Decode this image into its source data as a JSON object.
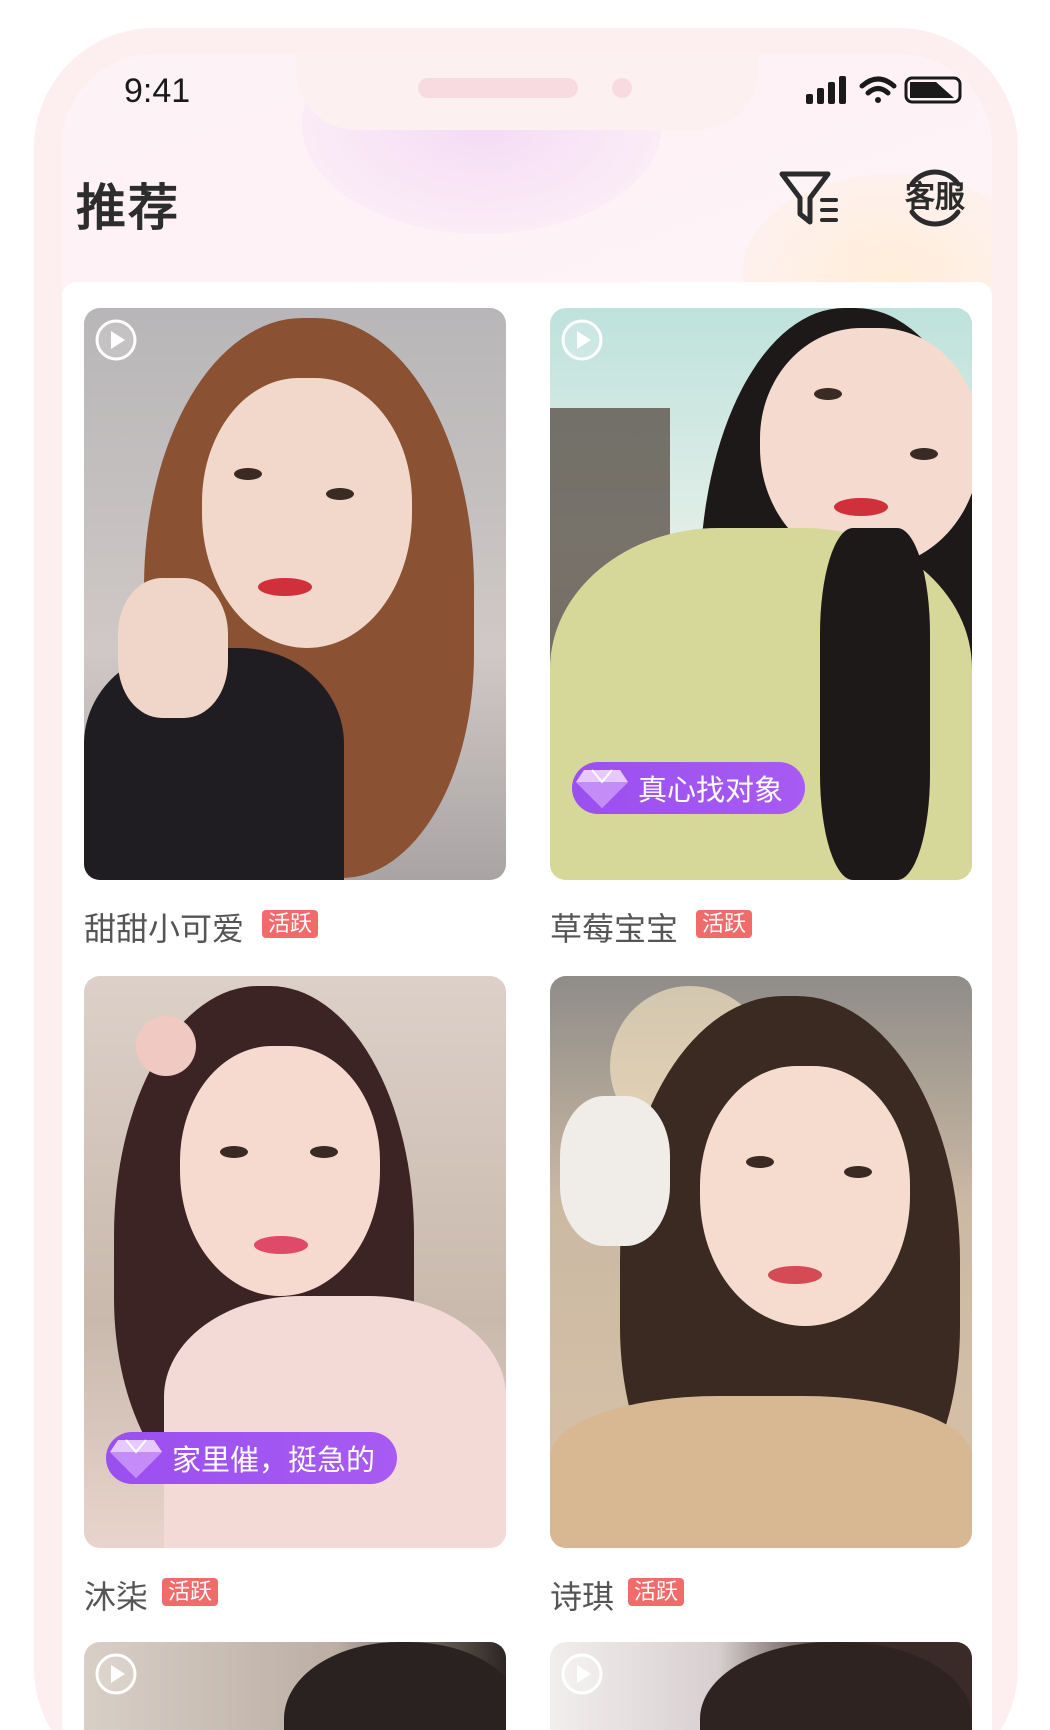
{
  "status_bar": {
    "time": "9:41"
  },
  "header": {
    "title": "推荐",
    "service_label": "客服"
  },
  "cards": [
    {
      "name": "甜甜小可爱",
      "badge": "活跃",
      "tag": ""
    },
    {
      "name": "草莓宝宝",
      "badge": "活跃",
      "tag": "真心找对象"
    },
    {
      "name": "沐柒",
      "badge": "活跃",
      "tag": "家里催，挺急的"
    },
    {
      "name": "诗琪",
      "badge": "活跃",
      "tag": ""
    }
  ],
  "colors": {
    "accent_purple": "#9a4ff0",
    "active_badge": "#f26b6b",
    "frame_pink": "#fdeff0",
    "title_text": "#2d2d2d"
  },
  "icons": [
    "signal-icon",
    "wifi-icon",
    "battery-icon",
    "filter-icon",
    "customer-service-icon",
    "play-icon",
    "diamond-icon"
  ]
}
